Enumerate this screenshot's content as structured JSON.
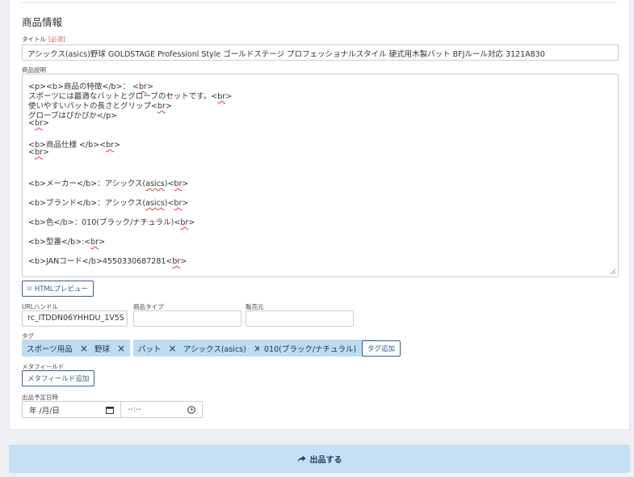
{
  "section_title": "商品情報",
  "title_field": {
    "label": "タイトル",
    "required": "[必須]",
    "value": "アシックス(asics)野球 GOLDSTAGE Professionl Style ゴールドステージ プロフェッショナルスタイル 硬式用木製バット BFJルール対応 3121A830"
  },
  "description": {
    "label": "商品説明",
    "lines": [
      "<p><b>商品の特徴</b>： <br>",
      "スポーツには最適なバットとグローブのセットです。<br>",
      "使いやすいバットの長さとグリップ<br>",
      "グローブはぴかぴか</p>",
      "<br>",
      "<b>商品仕様 </b><br>",
      "<br>",
      "<b>メーカー</b>：アシックス(asics)<br>",
      "<b>ブランド</b>：アシックス(asics)<br>",
      "<b>色</b>：010(ブラック/ナチュラル)<br>",
      "<b>型番</b>:<br>",
      "<b>JANコード</b>4550330687281<br>"
    ]
  },
  "html_preview_button": "HTMLプレビュー",
  "url_handle": {
    "label": "URLハンドル",
    "value": "rc_ITDDN06YHHDU_1V5S"
  },
  "product_type": {
    "label": "商品タイプ",
    "value": ""
  },
  "vendor": {
    "label": "販売元",
    "value": ""
  },
  "tags": {
    "label": "タグ",
    "items": [
      "スポーツ用品",
      "野球",
      "バット",
      "アシックス(asics)",
      "010(ブラック/ナチュラル)"
    ],
    "add_label": "タグ追加",
    "remove_glyph": "×"
  },
  "metafield": {
    "label": "メタフィールド",
    "add_label": "メタフィールド追加"
  },
  "schedule": {
    "label": "出品予定日時",
    "date_placeholder": "年 /月/日",
    "time_placeholder": "--:--"
  },
  "submit_label": "出品する",
  "colors": {
    "accent": "#2f5f93",
    "tag_bg": "#bcdcf2",
    "submit_bg": "#c5e0f4",
    "required": "#e0564b",
    "spellcheck": "#e0403a"
  },
  "icons": {
    "preview": "monitor-icon",
    "submit": "share-arrow-icon",
    "calendar": "calendar-icon",
    "clock": "clock-icon"
  }
}
